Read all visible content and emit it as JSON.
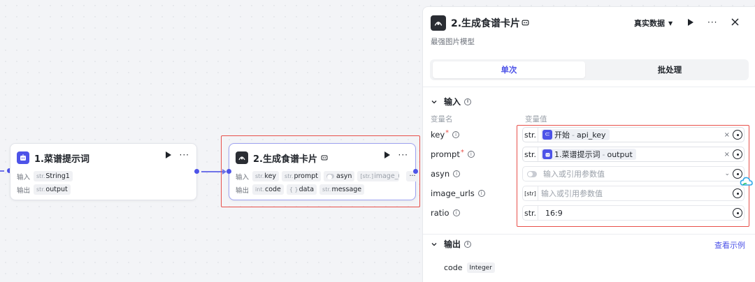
{
  "nodes": {
    "node1": {
      "title": "1.菜谱提示词",
      "input_label": "输入",
      "output_label": "输出",
      "input_chip": {
        "type": "str.",
        "name": "String1"
      },
      "output_chip": {
        "type": "str.",
        "name": "output"
      }
    },
    "node2": {
      "title": "2.生成食谱卡片",
      "input_label": "输入",
      "output_label": "输出",
      "inputs": [
        {
          "type": "str.",
          "name": "key"
        },
        {
          "type": "str.",
          "name": "prompt"
        },
        {
          "type": "",
          "name": "asyn"
        },
        {
          "type": "[str.]",
          "name": "image_urls"
        }
      ],
      "more": "···",
      "outputs": [
        {
          "type": "int.",
          "name": "code"
        },
        {
          "type": "{ }",
          "name": "data"
        },
        {
          "type": "str.",
          "name": "message"
        }
      ]
    }
  },
  "panel": {
    "title": "2.生成食谱卡片",
    "subtitle": "最强图片模型",
    "data_mode": "真实数据",
    "tabs": [
      "单次",
      "批处理"
    ],
    "input_section": "输入",
    "col_name": "变量名",
    "col_value": "变量值",
    "params": [
      {
        "name": "key",
        "required": true,
        "type": "str.",
        "ref_node": "开始",
        "ref_var": "api_key"
      },
      {
        "name": "prompt",
        "required": true,
        "type": "str.",
        "ref_node": "1.菜谱提示词",
        "ref_var": "output"
      },
      {
        "name": "asyn",
        "required": false,
        "placeholder": "输入或引用参数值"
      },
      {
        "name": "image_urls",
        "required": false,
        "type": "[str]",
        "placeholder": "输入或引用参数值"
      },
      {
        "name": "ratio",
        "required": false,
        "type": "str.",
        "value": "16:9"
      }
    ],
    "output_section": "输出",
    "view_example": "查看示例",
    "output_var": {
      "name": "code",
      "type": "Integer"
    }
  },
  "colors": {
    "accent": "#4d53e8",
    "highlight": "#e8504a"
  }
}
